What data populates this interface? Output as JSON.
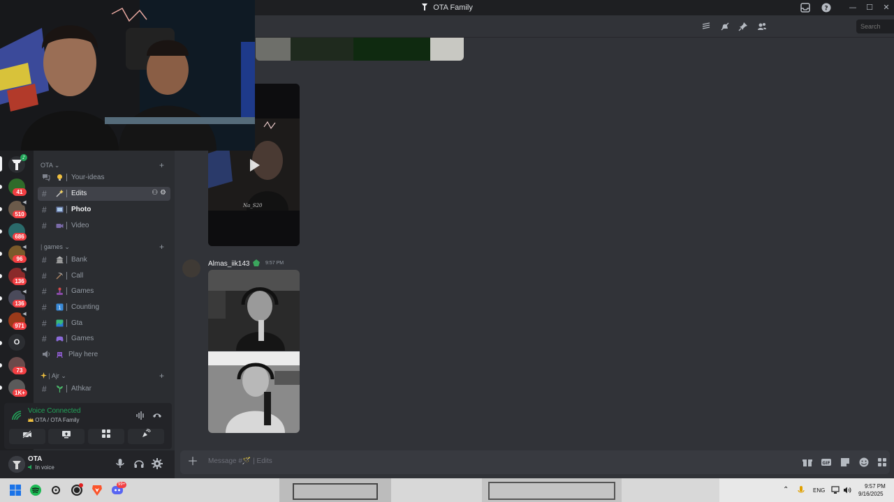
{
  "window": {
    "title": "OTA Family",
    "controls": [
      "—",
      "☐",
      "✕"
    ]
  },
  "server_rail": {
    "badges": [
      "41",
      "510",
      "686",
      "96",
      "136",
      "136",
      "971",
      "73",
      "1K+"
    ],
    "letter_server": "O"
  },
  "sidebar": {
    "categories": [
      {
        "label": "OTA ⌄"
      },
      {
        "label": "games ⌄"
      },
      {
        "label": "Ajr ⌄"
      }
    ],
    "channels": [
      {
        "name": "Your-ideas",
        "type": "forum"
      },
      {
        "name": "Edits",
        "type": "text",
        "active": true
      },
      {
        "name": "Photo",
        "type": "text",
        "unread": true
      },
      {
        "name": "Video",
        "type": "text"
      },
      {
        "name": "Bank",
        "type": "text"
      },
      {
        "name": "Call",
        "type": "text"
      },
      {
        "name": "Games",
        "type": "text"
      },
      {
        "name": "Counting",
        "type": "text"
      },
      {
        "name": "Gta",
        "type": "text"
      },
      {
        "name": "Games",
        "type": "text"
      },
      {
        "name": "Play here",
        "type": "voice"
      },
      {
        "name": "Athkar",
        "type": "text"
      }
    ]
  },
  "voice": {
    "status": "Voice Connected",
    "location": "OTA / OTA Family"
  },
  "user": {
    "name": "OTA",
    "status": "In voice"
  },
  "header": {
    "search_placeholder": "Search"
  },
  "messages": [
    {
      "author": "Almas_iik143",
      "time": "9:57 PM"
    }
  ],
  "video_caption": "Na_S20",
  "composer": {
    "placeholder": "Message #🪄 | Edits"
  },
  "taskbar": {
    "language": "ENG",
    "time": "9:57 PM",
    "date": "9/16/2025",
    "notification_count": "99+"
  },
  "colors": {
    "bg_main": "#313338",
    "bg_sidebar": "#2b2d31",
    "bg_rail": "#1e1f22",
    "voice_green": "#23a55a",
    "badge_red": "#f23f43"
  }
}
